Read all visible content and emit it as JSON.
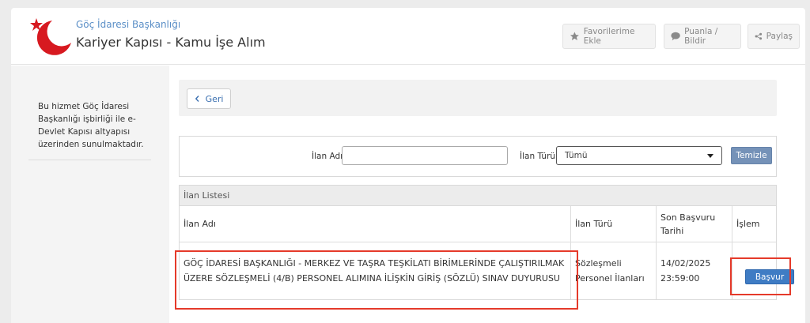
{
  "header": {
    "org_name": "Göç İdaresi Başkanlığı",
    "service_name": "Kariyer Kapısı - Kamu İşe Alım",
    "buttons": {
      "favorites": "Favorilerime Ekle",
      "rate": "Puanla / Bildir",
      "share": "Paylaş"
    }
  },
  "sidebar": {
    "info": "Bu hizmet Göç İdaresi Başkanlığı işbirliği ile e-Devlet Kapısı altyapısı üzerinden sunulmaktadır."
  },
  "main": {
    "back_label": "Geri",
    "filters": {
      "name_label": "İlan Adı",
      "name_value": "",
      "type_label": "İlan Türü",
      "type_value": "Tümü",
      "clear_label": "Temizle"
    },
    "list": {
      "title": "İlan Listesi",
      "columns": [
        "İlan Adı",
        "İlan Türü",
        "Son Başvuru Tarihi",
        "İşlem"
      ],
      "rows": [
        {
          "name": "GÖÇ İDARESİ BAŞKANLIĞI - MERKEZ VE TAŞRA TEŞKİLATI BİRİMLERİNDE ÇALIŞTIRILMAK ÜZERE SÖZLEŞMELİ (4/B) PERSONEL ALIMINA İLİŞKİN GİRİŞ (SÖZLÜ) SINAV DUYURUSU",
          "type": "Sözleşmeli Personel İlanları",
          "deadline": "14/02/2025 23:59:00",
          "action": "Başvur"
        }
      ]
    }
  },
  "colors": {
    "accent_blue": "#3f7cc4",
    "highlight_red": "#e53a2a",
    "logo_red": "#d71920"
  }
}
